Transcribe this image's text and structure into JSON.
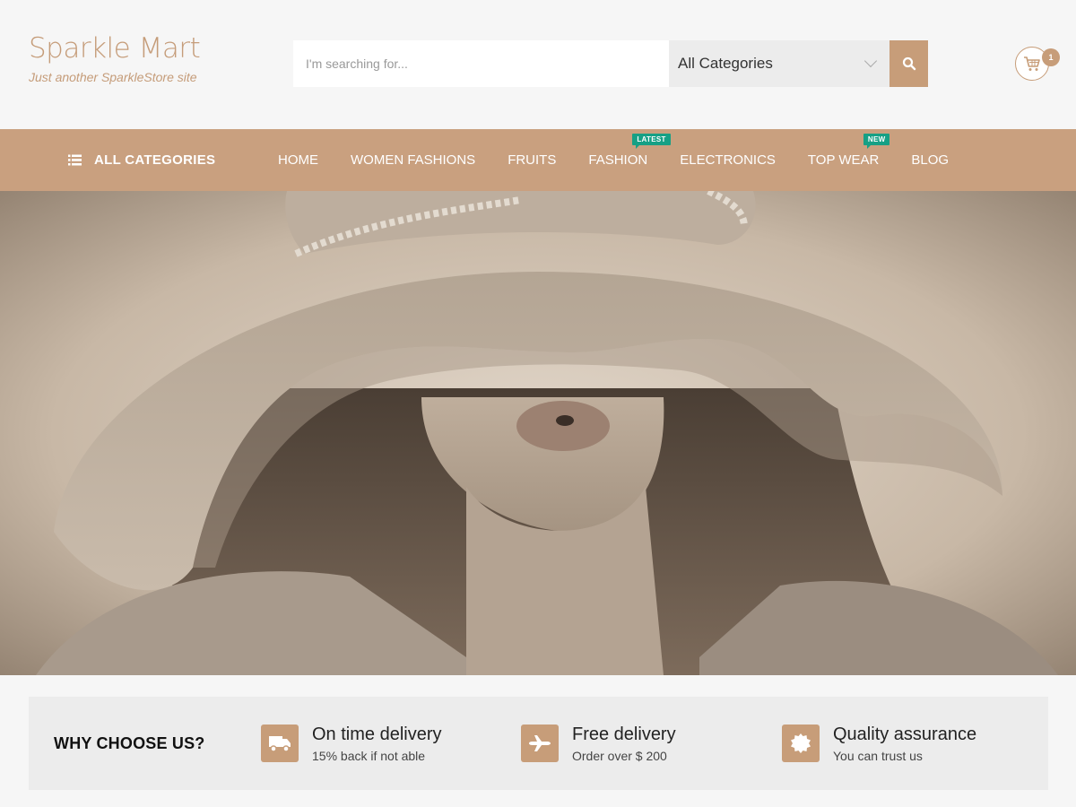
{
  "brand": {
    "title": "Sparkle Mart",
    "tagline": "Just another SparkleStore site"
  },
  "search": {
    "placeholder": "I'm searching for...",
    "category_selected": "All Categories",
    "button_icon": "search-icon"
  },
  "cart": {
    "icon": "cart-icon",
    "count": "1"
  },
  "nav": {
    "all_categories_label": "ALL CATEGORIES",
    "items": [
      {
        "label": "HOME",
        "tag": ""
      },
      {
        "label": "WOMEN FASHIONS",
        "tag": ""
      },
      {
        "label": "FRUITS",
        "tag": ""
      },
      {
        "label": "FASHION",
        "tag": "LATEST"
      },
      {
        "label": "ELECTRONICS",
        "tag": ""
      },
      {
        "label": "TOP WEAR",
        "tag": "NEW"
      },
      {
        "label": "BLOG",
        "tag": ""
      }
    ]
  },
  "hero": {
    "image_description": "sepia photo of woman in wide-brim hat"
  },
  "why": {
    "title": "WHY CHOOSE US?",
    "features": [
      {
        "icon": "truck-icon",
        "title": "On time delivery",
        "subtitle": "15% back if not able"
      },
      {
        "icon": "plane-icon",
        "title": "Free delivery",
        "subtitle": "Order over $ 200"
      },
      {
        "icon": "badge-icon",
        "title": "Quality assurance",
        "subtitle": "You can trust us"
      }
    ]
  },
  "colors": {
    "accent": "#c79d79",
    "nav_bg": "#c9a07f",
    "tag_green": "#16a085",
    "page_bg": "#f6f6f6"
  }
}
